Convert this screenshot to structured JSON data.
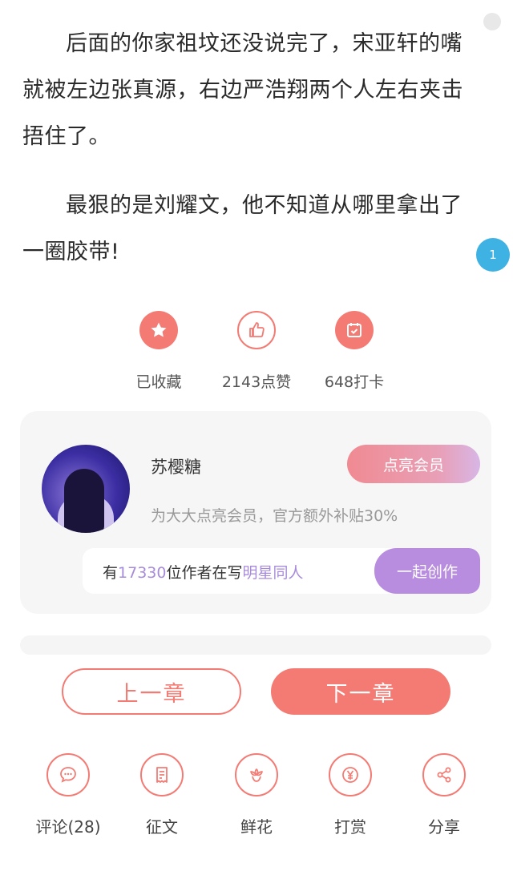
{
  "article": {
    "paragraph1": "后面的你家祖坟还没说完了，宋亚轩的嘴就被左边张真源，右边严浩翔两个人左右夹击捂住了。",
    "paragraph2": "最狠的是刘耀文，他不知道从哪里拿出了一圈胶带!",
    "comment_badge_count": "1"
  },
  "actions": {
    "favorite_label": "已收藏",
    "like_label": "2143点赞",
    "checkin_label": "648打卡"
  },
  "author_card": {
    "name": "苏樱糖",
    "vip_button": "点亮会员",
    "vip_desc": "为大大点亮会员，官方额外补贴30%",
    "writers_prefix": "有",
    "writers_count": "17330",
    "writers_middle": "位作者在写",
    "writers_topic": "明星同人",
    "join_button": "一起创作"
  },
  "navigation": {
    "prev_chapter": "上一章",
    "next_chapter": "下一章"
  },
  "bottom_bar": {
    "comment_label": "评论(28)",
    "essay_label": "征文",
    "flower_label": "鲜花",
    "reward_label": "打赏",
    "share_label": "分享"
  },
  "colors": {
    "accent": "#f37b74",
    "purple": "#b88ddf",
    "badge_blue": "#3fb2e4"
  }
}
